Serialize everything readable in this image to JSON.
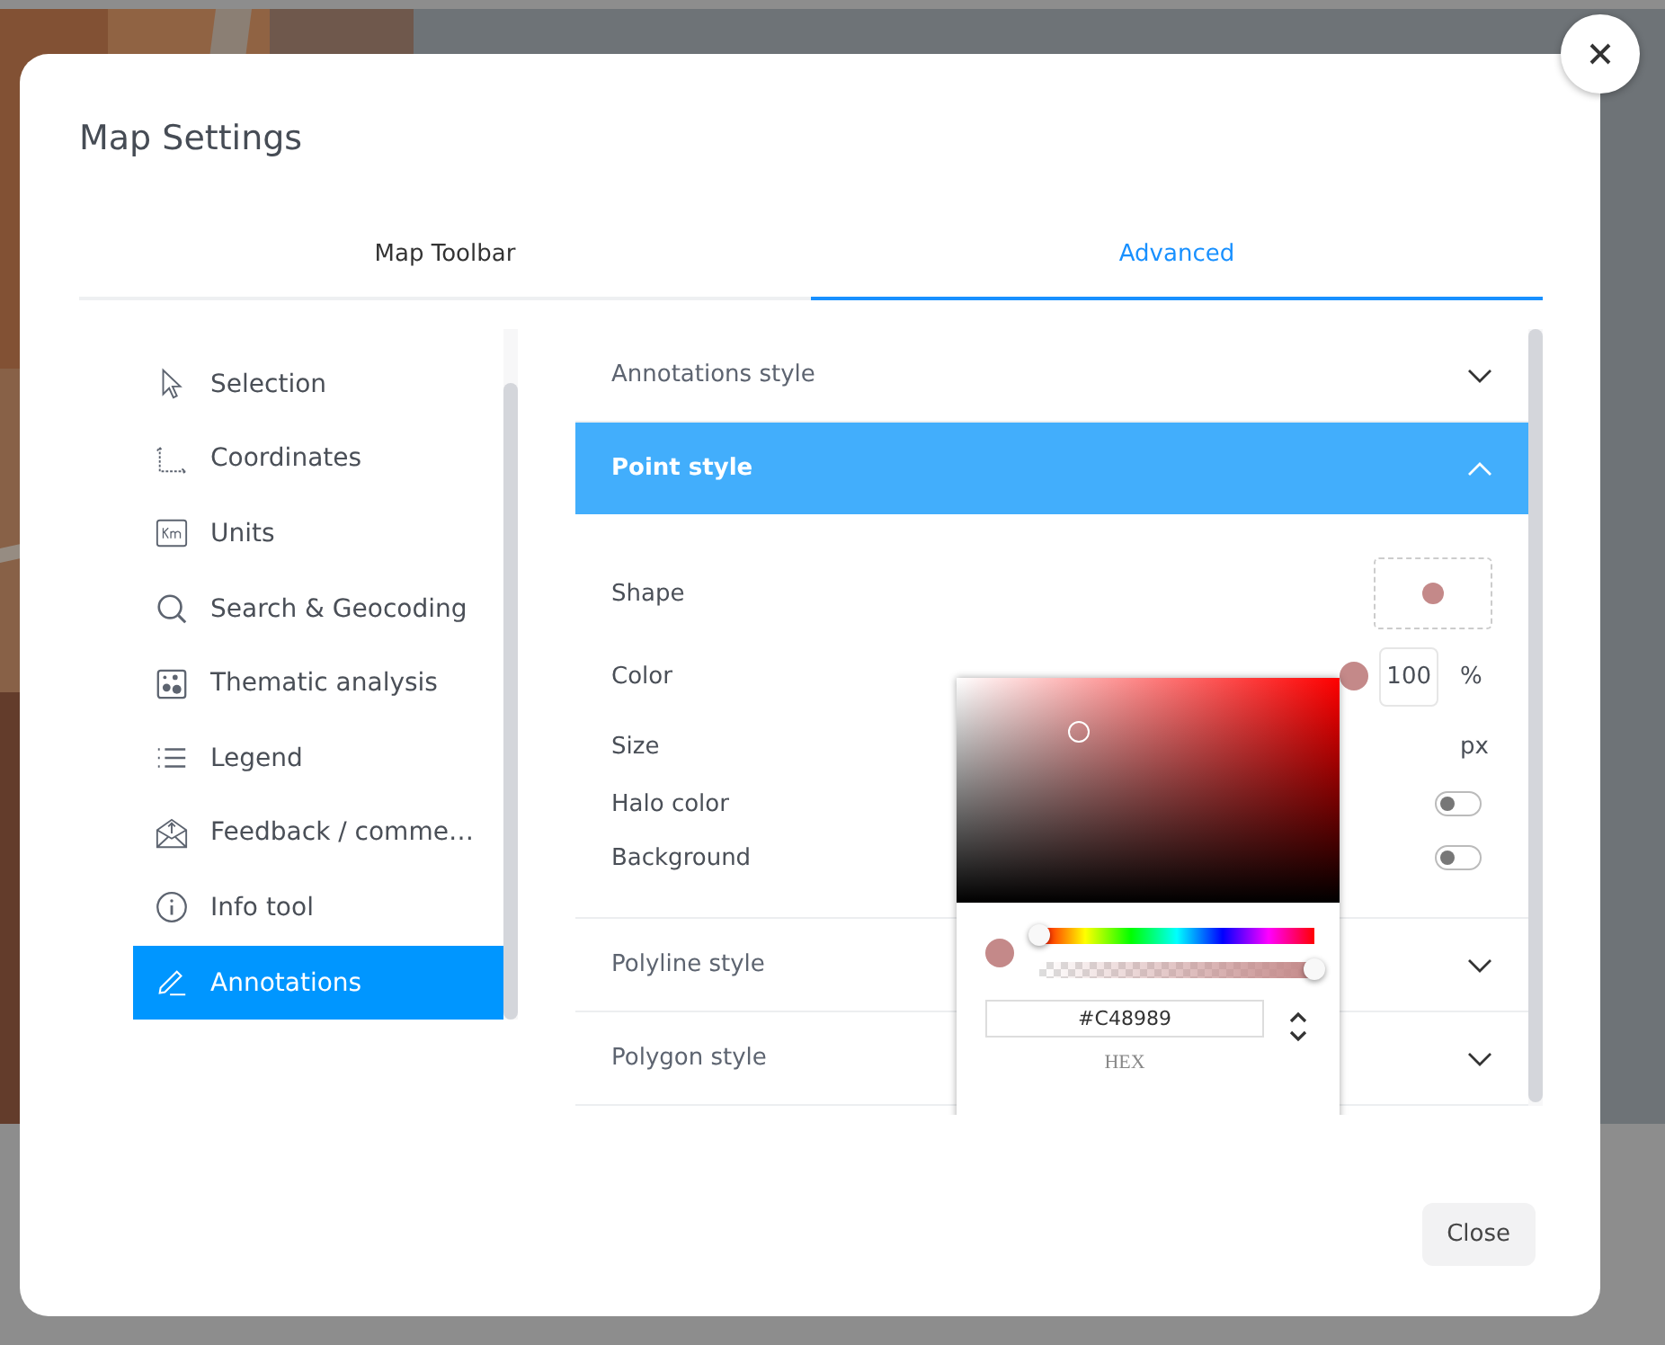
{
  "dialog": {
    "title": "Map Settings"
  },
  "tabs": [
    {
      "label": "Map Toolbar",
      "selected": false
    },
    {
      "label": "Advanced",
      "selected": true
    }
  ],
  "sidebar": {
    "items": [
      {
        "label": "Selection",
        "selected": false
      },
      {
        "label": "Coordinates",
        "selected": false
      },
      {
        "label": "Units",
        "selected": false
      },
      {
        "label": "Search & Geocoding",
        "selected": false
      },
      {
        "label": "Thematic analysis",
        "selected": false
      },
      {
        "label": "Legend",
        "selected": false
      },
      {
        "label": "Feedback / comme…",
        "selected": false
      },
      {
        "label": "Info tool",
        "selected": false
      },
      {
        "label": "Annotations",
        "selected": true
      }
    ]
  },
  "sections": [
    {
      "title": "Annotations style",
      "expanded": false
    },
    {
      "title": "Point style",
      "expanded": true,
      "fields": [
        {
          "kind": "shape",
          "label": "Shape",
          "color": "#c48989"
        },
        {
          "kind": "color",
          "label": "Color",
          "color": "#c48989",
          "value": "100",
          "unit": "%"
        },
        {
          "kind": "size",
          "label": "Size",
          "unit": "px"
        },
        {
          "kind": "toggle",
          "label": "Halo color",
          "on": false
        },
        {
          "kind": "toggle",
          "label": "Background",
          "on": false
        }
      ]
    },
    {
      "title": "Polyline style",
      "expanded": false
    },
    {
      "title": "Polygon style",
      "expanded": false
    }
  ],
  "color_picker": {
    "hex": "#C48989",
    "mode": "HEX",
    "hue": {
      "level": 0
    },
    "alpha": {
      "level": 1
    }
  },
  "footer": {
    "close_button": "Close"
  }
}
